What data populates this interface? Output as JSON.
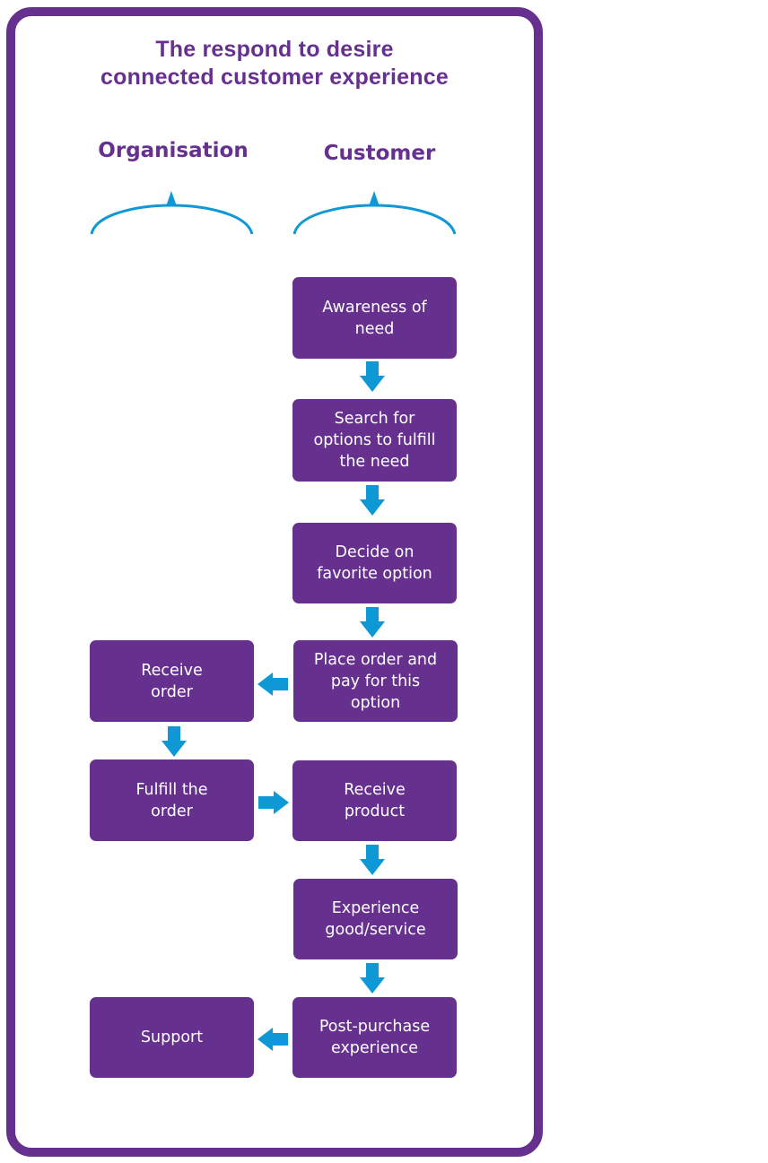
{
  "title": {
    "line1": "The respond to desire",
    "line2": "connected customer experience"
  },
  "columns": {
    "organisation": "Organisation",
    "customer": "Customer"
  },
  "colors": {
    "primary": "#66308e",
    "accent": "#0e98d5",
    "box_text": "#ffffff"
  },
  "customer_steps": [
    {
      "label": "Awareness of need",
      "lines": [
        "Awareness of",
        "need"
      ]
    },
    {
      "label": "Search for options to fulfill the need",
      "lines": [
        "Search for",
        "options to fulfill",
        "the need"
      ]
    },
    {
      "label": "Decide on favorite option",
      "lines": [
        "Decide on",
        "favorite option"
      ]
    },
    {
      "label": "Place order and pay for this option",
      "lines": [
        "Place order and",
        "pay for this",
        "option"
      ]
    },
    {
      "label": "Receive product",
      "lines": [
        "Receive",
        "product"
      ]
    },
    {
      "label": "Experience good/service",
      "lines": [
        "Experience",
        "good/service"
      ]
    },
    {
      "label": "Post-purchase experience",
      "lines": [
        "Post-purchase",
        "experience"
      ]
    }
  ],
  "organisation_steps": [
    {
      "label": "Receive order",
      "lines": [
        "Receive",
        "order"
      ]
    },
    {
      "label": "Fulfill the order",
      "lines": [
        "Fulfill the",
        "order"
      ]
    },
    {
      "label": "Support",
      "lines": [
        "Support"
      ]
    }
  ],
  "connections": [
    {
      "from": "Awareness of need",
      "to": "Search for options to fulfill the need",
      "direction": "down"
    },
    {
      "from": "Search for options to fulfill the need",
      "to": "Decide on favorite option",
      "direction": "down"
    },
    {
      "from": "Decide on favorite option",
      "to": "Place order and pay for this option",
      "direction": "down"
    },
    {
      "from": "Place order and pay for this option",
      "to": "Receive order",
      "direction": "left"
    },
    {
      "from": "Receive order",
      "to": "Fulfill the order",
      "direction": "down"
    },
    {
      "from": "Fulfill the order",
      "to": "Receive product",
      "direction": "right"
    },
    {
      "from": "Receive product",
      "to": "Experience good/service",
      "direction": "down"
    },
    {
      "from": "Experience good/service",
      "to": "Post-purchase experience",
      "direction": "down"
    },
    {
      "from": "Post-purchase experience",
      "to": "Support",
      "direction": "left"
    }
  ]
}
